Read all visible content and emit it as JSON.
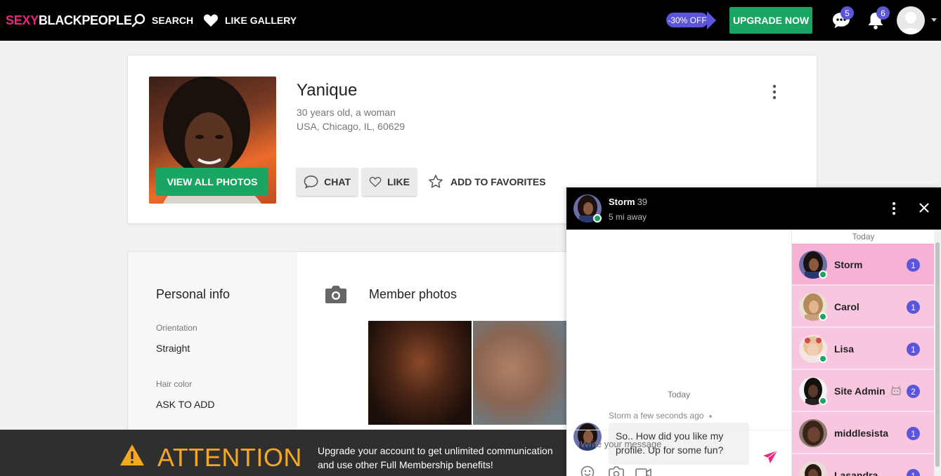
{
  "header": {
    "logo_part1": "SEXY",
    "logo_part2": "BLACKPEOPLE",
    "nav_search": "SEARCH",
    "nav_like_gallery": "LIKE GALLERY",
    "discount": "-30% OFF",
    "upgrade": "UPGRADE NOW",
    "messages_count": "5",
    "notifications_count": "6"
  },
  "profile": {
    "name": "Yanique",
    "age_gender": "30 years old, a woman",
    "location": "USA, Chicago, IL, 60629",
    "view_all_photos": "VIEW ALL PHOTOS",
    "chat": "CHAT",
    "like": "LIKE",
    "add_to_favorites": "ADD TO FAVORITES"
  },
  "personal_info": {
    "title": "Personal info",
    "orientation_label": "Orientation",
    "orientation_value": "Straight",
    "hair_label": "Hair color",
    "hair_value": "ASK TO ADD"
  },
  "member_photos": {
    "title": "Member photos"
  },
  "attention": {
    "title": "ATTENTION",
    "text": "Upgrade your account to get unlimited communication and use other Full Membership benefits!"
  },
  "chat": {
    "name": "Storm",
    "age": "39",
    "distance": "5 mi away",
    "day_label": "Today",
    "msg_sender": "Storm",
    "msg_time": "a few seconds ago",
    "msg_text": "So.. How did you like my profile. Up for some fun?",
    "input_placeholder": "Write your message",
    "contacts_day": "Today",
    "contacts": [
      {
        "name": "Storm",
        "unread": "1"
      },
      {
        "name": "Carol",
        "unread": "1"
      },
      {
        "name": "Lisa",
        "unread": "1"
      },
      {
        "name": "Site Admin",
        "unread": "2"
      },
      {
        "name": "middlesista",
        "unread": "1"
      },
      {
        "name": "Lasandra",
        "unread": "1"
      }
    ]
  },
  "colors": {
    "brand_pink": "#e6277d",
    "green": "#1aa562",
    "purple": "#5c55d9",
    "attention_orange": "#f5a623"
  }
}
